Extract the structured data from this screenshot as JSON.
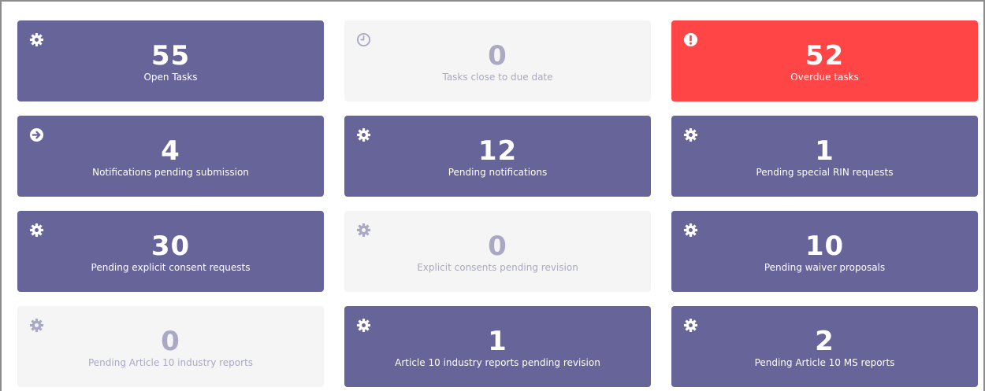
{
  "colors": {
    "active": "#666499",
    "empty": "#f5f5f5",
    "empty_text": "#a9a9c4",
    "alert": "#ff4545",
    "text_light": "#ffffff"
  },
  "tiles": [
    {
      "count": "55",
      "label": "Open Tasks",
      "state": "active",
      "icon": "gear-icon"
    },
    {
      "count": "0",
      "label": "Tasks close to due date",
      "state": "empty",
      "icon": "clock-icon"
    },
    {
      "count": "52",
      "label": "Overdue tasks",
      "state": "alert",
      "icon": "exclamation-icon"
    },
    {
      "count": "4",
      "label": "Notifications pending submission",
      "state": "active",
      "icon": "arrow-right-circle-icon"
    },
    {
      "count": "12",
      "label": "Pending notifications",
      "state": "active",
      "icon": "gear-icon"
    },
    {
      "count": "1",
      "label": "Pending special RIN requests",
      "state": "active",
      "icon": "gear-icon"
    },
    {
      "count": "30",
      "label": "Pending explicit consent requests",
      "state": "active",
      "icon": "gear-icon"
    },
    {
      "count": "0",
      "label": "Explicit consents pending revision",
      "state": "empty",
      "icon": "gear-icon"
    },
    {
      "count": "10",
      "label": "Pending waiver proposals",
      "state": "active",
      "icon": "gear-icon"
    },
    {
      "count": "0",
      "label": "Pending Article 10 industry reports",
      "state": "empty",
      "icon": "gear-icon"
    },
    {
      "count": "1",
      "label": "Article 10 industry reports pending revision",
      "state": "active",
      "icon": "gear-icon"
    },
    {
      "count": "2",
      "label": "Pending Article 10 MS reports",
      "state": "active",
      "icon": "gear-icon"
    }
  ]
}
